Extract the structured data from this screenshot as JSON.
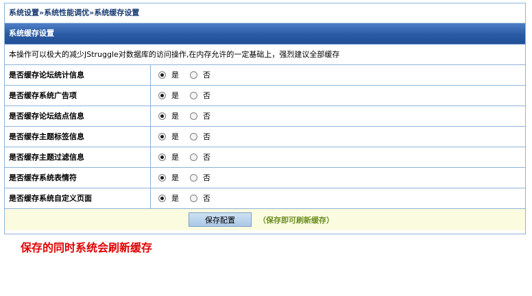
{
  "breadcrumb": "系统设置»系统性能调优»系统缓存设置",
  "panel": {
    "title": "系统缓存设置",
    "notice": "本操作可以极大的减少JStruggle对数据库的访问操作,在内存允许的一定基础上，强烈建议全部缓存"
  },
  "options": {
    "yes_label": "是",
    "no_label": "否"
  },
  "settings": [
    {
      "label": "是否缓存论坛统计信息",
      "value": "是"
    },
    {
      "label": "是否缓存系统广告项",
      "value": "是"
    },
    {
      "label": "是否缓存论坛结点信息",
      "value": "是"
    },
    {
      "label": "是否缓存主题标签信息",
      "value": "是"
    },
    {
      "label": "是否缓存主题过滤信息",
      "value": "是"
    },
    {
      "label": "是否缓存系统表情符",
      "value": "是"
    },
    {
      "label": "是否缓存系统自定义页面",
      "value": "是"
    }
  ],
  "footer": {
    "save_label": "保存配置",
    "save_hint": "（保存即可刷新缓存）"
  },
  "note": "保存的同时系统会刷新缓存",
  "colors": {
    "border": "#8eb2d6",
    "header_bg": "#2a5aa3",
    "footer_bg": "#fbfbe0",
    "hint": "#6b8e23",
    "note": "#e00000"
  }
}
